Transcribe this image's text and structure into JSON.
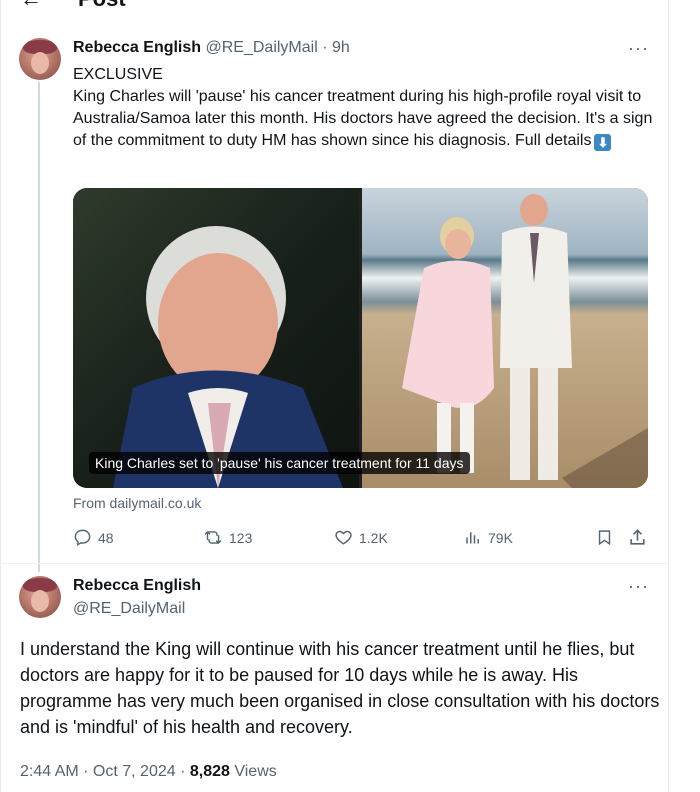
{
  "header": {
    "title": "Post"
  },
  "tweet1": {
    "author_name": "Rebecca English",
    "author_handle": "@RE_DailyMail",
    "time": "· 9h",
    "text_line1": "EXCLUSIVE",
    "text_body": "King Charles will 'pause' his cancer treatment during his high-profile royal visit to Australia/Samoa later this month. His doctors have agreed the decision. It's a sign of the commitment to duty HM has shown since his diagnosis. Full details",
    "emoji": "⬇",
    "card_caption": "King Charles set to 'pause' his cancer treatment for 11 days",
    "card_source": "From dailymail.co.uk",
    "replies": "48",
    "reposts": "123",
    "likes": "1.2K",
    "views": "79K"
  },
  "tweet2": {
    "author_name": "Rebecca English",
    "author_handle": "@RE_DailyMail",
    "text": "I understand the King will continue with his cancer treatment until he flies, but doctors are happy for it to be paused for 10 days while he is away. His programme has very much been organised in close consultation with his doctors and is 'mindful' of his health and recovery.",
    "timestamp": "2:44 AM · Oct 7, 2024 · ",
    "views_count": "8,828",
    "views_label": " Views"
  },
  "colors": {
    "text": "#0f1419",
    "secondary": "#536471",
    "divider": "#eff3f4",
    "thread_line": "#cfd9de"
  }
}
